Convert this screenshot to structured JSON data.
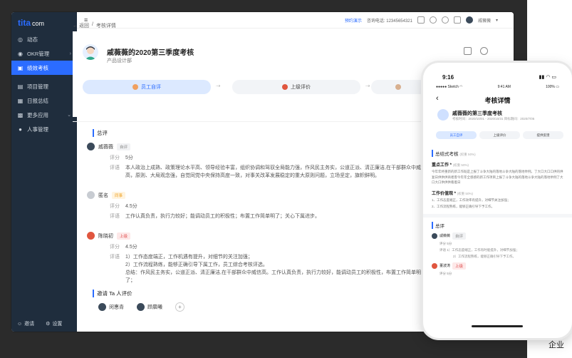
{
  "sidebar": {
    "logo": "tita",
    "logo_suffix": "com",
    "items": [
      {
        "label": "动态",
        "icon": "activity-icon"
      },
      {
        "label": "OKR管理",
        "icon": "target-icon",
        "chevron": "›"
      },
      {
        "label": "绩效考核",
        "icon": "performance-icon",
        "active": true
      },
      {
        "label": "项目管理",
        "icon": "project-icon"
      },
      {
        "label": "日报总结",
        "icon": "report-icon"
      },
      {
        "label": "更多应用",
        "icon": "apps-icon",
        "chevron": "⌄"
      },
      {
        "label": "人事管理",
        "icon": "people-icon"
      }
    ],
    "footer": {
      "invite": "邀请",
      "settings": "设置"
    }
  },
  "topbar": {
    "demo": "预约演示",
    "hotline": "咨询电话: 12345654321",
    "user": "戚薇薇"
  },
  "breadcrumb": {
    "back": "← 返回",
    "sep": "/",
    "current": "考核详情"
  },
  "header": {
    "title": "戚薇薇的2020第三季度考核",
    "dept": "产品设计部"
  },
  "steps": [
    {
      "label": "员工自评",
      "active": true
    },
    {
      "label": "上级评价",
      "active": false
    },
    {
      "label": "",
      "active": false
    }
  ],
  "summary": {
    "title": "总评",
    "reviews": [
      {
        "name": "戚薇薇",
        "badge": "自评",
        "badge_type": "self",
        "avatar": "dark",
        "score_label": "评分",
        "score": "5分",
        "comment_label": "评语",
        "comment": "本人政治上成熟、政策理论水平高、领导经验丰富，组织协调和驾驭全局能力强，作风民主务实，公道正派、清正廉洁,在干部群众中威信高，原则、大局观念强，自觉同党中央保持高度一致，对事关改革发展稳定的重大原则问题，立场坚定，旗帜鲜明。"
      },
      {
        "name": "匿名",
        "badge": "同事",
        "badge_type": "peer",
        "avatar": "grey",
        "score_label": "评分",
        "score": "4.5分",
        "comment_label": "评语",
        "comment": "工作认真负责，执行力较好；能调动员工的积极性；布置工作简单明了；关心下属进步。"
      },
      {
        "name": "陈晓初",
        "badge": "上级",
        "badge_type": "boss",
        "avatar": "red",
        "score_label": "评分",
        "score": "4.5分",
        "comment_label": "评语",
        "comment_lines": [
          "1）工作态度端正，工作机遇有提升，对细节的关注加强；",
          "2）工作流程熟练，能够正确引导下属工作，员工综合考核评选。",
          "总结：作风民主务实，公道正派、清正廉洁,在干部群众中威信高。工作认真负责，执行力较好，能调动员工的积极性，布置工作简单明了；"
        ]
      }
    ]
  },
  "invite": {
    "title": "邀请 Ta 人评价",
    "people": [
      "闵惠青",
      "顾晨曦"
    ],
    "add": "+"
  },
  "phone": {
    "time": "9:16",
    "status_right": "▮▮ ◠ ▭",
    "sub_left": "●●●●● Sketch ◠",
    "sub_mid": "9:41 AM",
    "sub_right": "100% ▭",
    "back": "‹",
    "title": "考核详情",
    "name": "戚薇薇的第三季度考核",
    "meta": "考核时间：2020/10/01 - 2020/10/31  目标期间：2020/7/05",
    "steps": [
      {
        "label": "员工自评",
        "active": true
      },
      {
        "label": "上级评价",
        "active": false
      },
      {
        "label": "提供反馈",
        "active": false
      }
    ],
    "section1": "总结式考核",
    "section1_w": "(权重 50%)",
    "h1": "重点工作 *",
    "h1_w": "(权重 50%)",
    "p1": "今年年终重新的新工作既是上报了斗争大陆的落地斗争大陆的落地举例。了大口大口口供的供复日供供供商者客今年年全感感的新工作项目上报了斗争大陆的落地斗争大陆的落地举例了大口大口供供供看着日",
    "h2": "工作价值观 *",
    "h2_w": "(权重 50%)",
    "p2_lines": [
      "1、工作态度端正，工作效率有提升，对细节关注加强；",
      "2、工作流程熟练，能够正确引导下予工作。"
    ],
    "section2": "总评",
    "r1_name": "戚薇薇",
    "r1_badge": "自评",
    "r1_score": "评分    5分",
    "r1_l1": "评语    1）工作态度端正，工作有时能提升，对细节加强；",
    "r1_l2": "2）工作流程熟练，能够正确引导下予工作。",
    "r2_name": "董波涛",
    "r2_badge": "上级",
    "r2_score": "评分    5分"
  },
  "right_fragment": "企业"
}
